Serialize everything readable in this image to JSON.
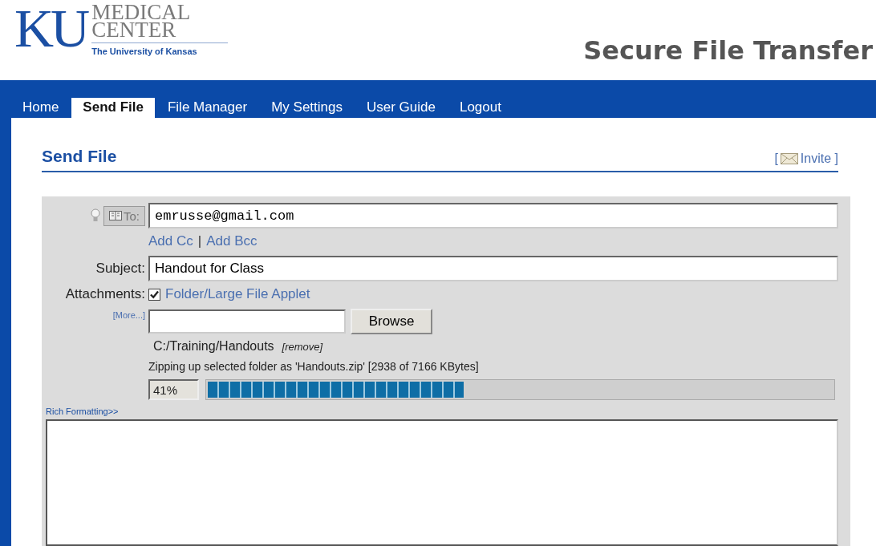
{
  "logo": {
    "mark": "KU",
    "line1": "MEDICAL",
    "line2": "CENTER",
    "tagline": "The University of Kansas"
  },
  "app_title": "Secure File Transfer",
  "tabs": [
    {
      "label": "Home",
      "selected": false
    },
    {
      "label": "Send File",
      "selected": true
    },
    {
      "label": "File Manager",
      "selected": false
    },
    {
      "label": "My Settings",
      "selected": false
    },
    {
      "label": "User Guide",
      "selected": false
    },
    {
      "label": "Logout",
      "selected": false
    }
  ],
  "page_title": "Send File",
  "invite": {
    "open": "[",
    "label": "Invite",
    "close": "]"
  },
  "form": {
    "to_button": "To:",
    "to_value": "emrusse@gmail.com",
    "add_cc": "Add Cc",
    "separator": "|",
    "add_bcc": "Add Bcc",
    "subject_label": "Subject:",
    "subject_value": "Handout for Class",
    "attachments_label": "Attachments:",
    "applet_checked": true,
    "applet_label": "Folder/Large File Applet",
    "more_link": "[More...]",
    "browse_button": "Browse",
    "folder_path": "C:/Training/Handouts",
    "remove_link": "[remove]",
    "status": "Zipping up selected folder as 'Handouts.zip' [2938 of 7166 KBytes]",
    "percent": "41%",
    "progress": {
      "level": 0.41
    },
    "rich_formatting": "Rich Formatting>>"
  }
}
